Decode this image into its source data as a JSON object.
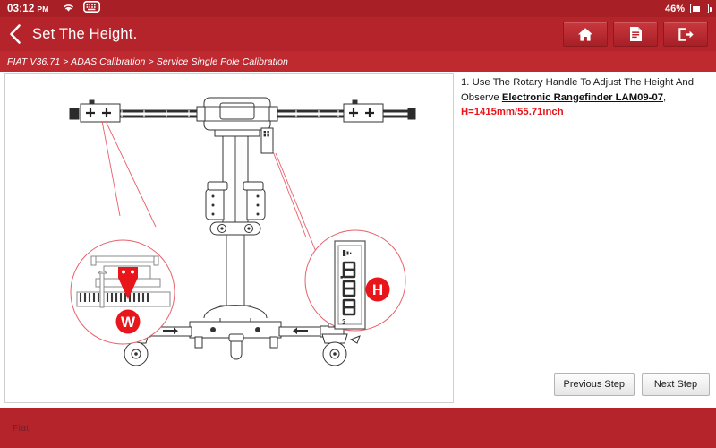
{
  "status_bar": {
    "time": "03:12",
    "ampm": "PM",
    "wifi_icon": "wifi-icon",
    "keyboard_icon": "keyboard-icon",
    "battery_percent": "46%",
    "battery_icon": "battery-icon",
    "battery_level": 46
  },
  "header": {
    "back_icon": "back-chevron-icon",
    "title": "Set The Height.",
    "toolbar": [
      {
        "name": "home-button",
        "icon": "home-icon"
      },
      {
        "name": "report-button",
        "icon": "report-icon"
      },
      {
        "name": "exit-button",
        "icon": "exit-icon"
      }
    ]
  },
  "breadcrumb": {
    "text": "FIAT V36.71 > ADAS Calibration > Service Single Pole Calibration",
    "segments": [
      "FIAT V36.71",
      "ADAS Calibration",
      "Service Single Pole Calibration"
    ]
  },
  "diagram": {
    "name": "single-pole-calibration-rig-diagram",
    "callouts": [
      {
        "label": "W",
        "description": "width scale detail with red pointer"
      },
      {
        "label": "H",
        "description": "electronic rangefinder height display detail"
      }
    ],
    "rangefinder_display": "8.888"
  },
  "instruction": {
    "number": "1.",
    "text_before": "Use The Rotary Handle To Adjust The Height And Observe ",
    "device": "Electronic Rangefinder LAM09-07",
    "comma": ",",
    "h_prefix": "H=",
    "h_value": "1415mm/55.71inch",
    "full_text": "1. Use The Rotary Handle To Adjust The Height And Observe Electronic Rangefinder LAM09-07, H=1415mm/55.71inch"
  },
  "buttons": {
    "previous_step": "Previous Step",
    "next_step": "Next Step"
  },
  "footer": {
    "label": "Fiat"
  },
  "colors": {
    "header_red": "#b5242b",
    "statusbar_red": "#a82026",
    "breadcrumb_red": "#bf2a31",
    "accent_red": "#e8151b",
    "panel_white": "#ffffff",
    "footer_text": "#6e2226"
  }
}
